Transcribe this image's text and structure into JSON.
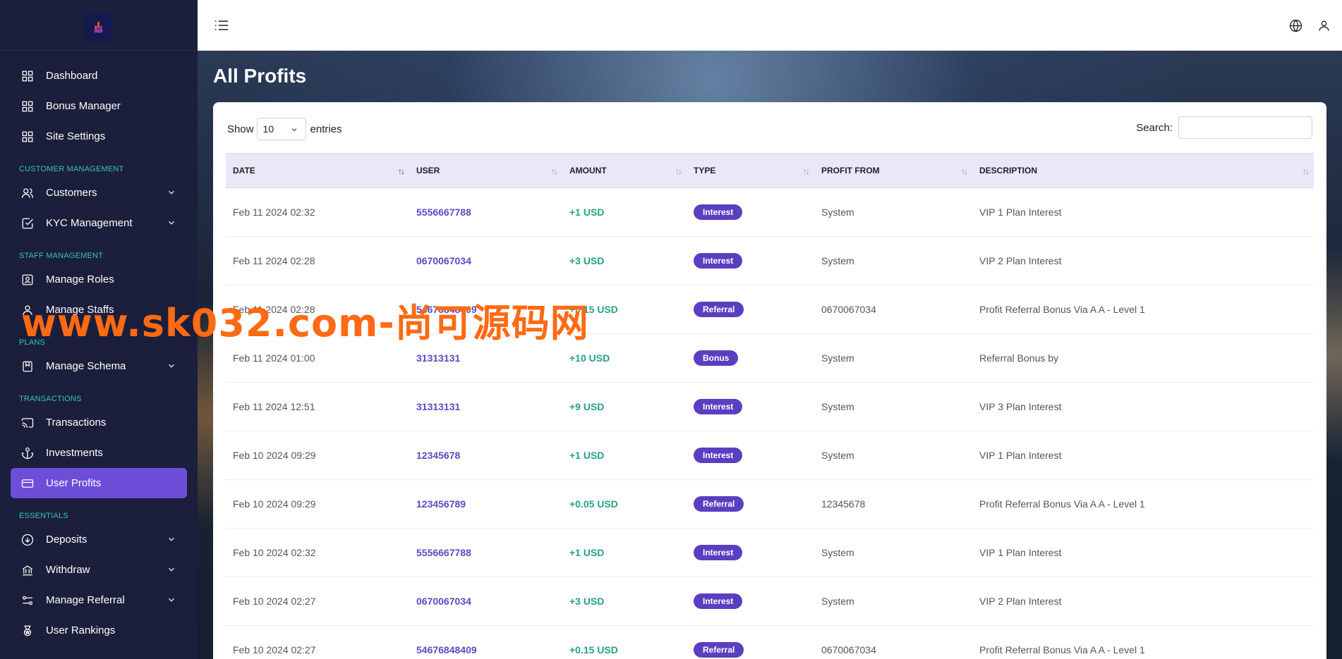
{
  "header": {
    "menu_icon": "list-icon",
    "language_icon": "globe-icon",
    "profile_icon": "user-icon"
  },
  "sidebar": {
    "logo_icon": "hand-logo-icon",
    "items": [
      {
        "label": "Dashboard",
        "icon": "grid-icon"
      },
      {
        "label": "Bonus Manager",
        "icon": "grid-icon"
      },
      {
        "label": "Site Settings",
        "icon": "grid-icon"
      }
    ],
    "sections": [
      {
        "title": "CUSTOMER MANAGEMENT",
        "items": [
          {
            "label": "Customers",
            "icon": "users-icon",
            "expandable": true
          },
          {
            "label": "KYC Management",
            "icon": "checkbox-icon",
            "expandable": true
          }
        ]
      },
      {
        "title": "STAFF MANAGEMENT",
        "items": [
          {
            "label": "Manage Roles",
            "icon": "id-badge-icon"
          },
          {
            "label": "Manage Staffs",
            "icon": "user-icon"
          }
        ]
      },
      {
        "title": "PLANS",
        "items": [
          {
            "label": "Manage Schema",
            "icon": "bookmark-icon",
            "expandable": true
          }
        ]
      },
      {
        "title": "TRANSACTIONS",
        "items": [
          {
            "label": "Transactions",
            "icon": "cast-icon"
          },
          {
            "label": "Investments",
            "icon": "anchor-icon"
          },
          {
            "label": "User Profits",
            "icon": "credit-card-icon",
            "active": true
          }
        ]
      },
      {
        "title": "ESSENTIALS",
        "items": [
          {
            "label": "Deposits",
            "icon": "arrow-down-circle-icon",
            "expandable": true
          },
          {
            "label": "Withdraw",
            "icon": "bank-icon",
            "expandable": true
          },
          {
            "label": "Manage Referral",
            "icon": "sliders-icon",
            "expandable": true
          },
          {
            "label": "User Rankings",
            "icon": "medal-icon"
          }
        ]
      }
    ]
  },
  "main": {
    "title": "All Profits",
    "show_label": "Show",
    "entries_value": "10",
    "entries_label": "entries",
    "search_label": "Search:",
    "search_value": "",
    "columns": [
      "DATE",
      "USER",
      "AMOUNT",
      "TYPE",
      "PROFIT FROM",
      "DESCRIPTION"
    ],
    "rows": [
      {
        "date": "Feb 11 2024 02:32",
        "user": "5556667788",
        "amount": "+1 USD",
        "type": "Interest",
        "profit_from": "System",
        "description": "VIP 1 Plan Interest"
      },
      {
        "date": "Feb 11 2024 02:28",
        "user": "0670067034",
        "amount": "+3 USD",
        "type": "Interest",
        "profit_from": "System",
        "description": "VIP 2 Plan Interest"
      },
      {
        "date": "Feb 11 2024 02:28",
        "user": "54676848409",
        "amount": "+0.15 USD",
        "type": "Referral",
        "profit_from": "0670067034",
        "description": "Profit Referral Bonus Via A A - Level 1"
      },
      {
        "date": "Feb 11 2024 01:00",
        "user": "31313131",
        "amount": "+10 USD",
        "type": "Bonus",
        "profit_from": "System",
        "description": "Referral Bonus by"
      },
      {
        "date": "Feb 11 2024 12:51",
        "user": "31313131",
        "amount": "+9 USD",
        "type": "Interest",
        "profit_from": "System",
        "description": "VIP 3 Plan Interest"
      },
      {
        "date": "Feb 10 2024 09:29",
        "user": "12345678",
        "amount": "+1 USD",
        "type": "Interest",
        "profit_from": "System",
        "description": "VIP 1 Plan Interest"
      },
      {
        "date": "Feb 10 2024 09:29",
        "user": "123456789",
        "amount": "+0.05 USD",
        "type": "Referral",
        "profit_from": "12345678",
        "description": "Profit Referral Bonus Via A A - Level 1"
      },
      {
        "date": "Feb 10 2024 02:32",
        "user": "5556667788",
        "amount": "+1 USD",
        "type": "Interest",
        "profit_from": "System",
        "description": "VIP 1 Plan Interest"
      },
      {
        "date": "Feb 10 2024 02:27",
        "user": "0670067034",
        "amount": "+3 USD",
        "type": "Interest",
        "profit_from": "System",
        "description": "VIP 2 Plan Interest"
      },
      {
        "date": "Feb 10 2024 02:27",
        "user": "54676848409",
        "amount": "+0.15 USD",
        "type": "Referral",
        "profit_from": "0670067034",
        "description": "Profit Referral Bonus Via A A - Level 1"
      }
    ]
  },
  "watermark": "www.sk032.com-尚可源码网",
  "colors": {
    "sidebar_bg": "#1b1f3b",
    "accent": "#6c4ed8",
    "badge": "#5a3fc0",
    "amount": "#23a386",
    "section_title": "#37c5b0"
  }
}
